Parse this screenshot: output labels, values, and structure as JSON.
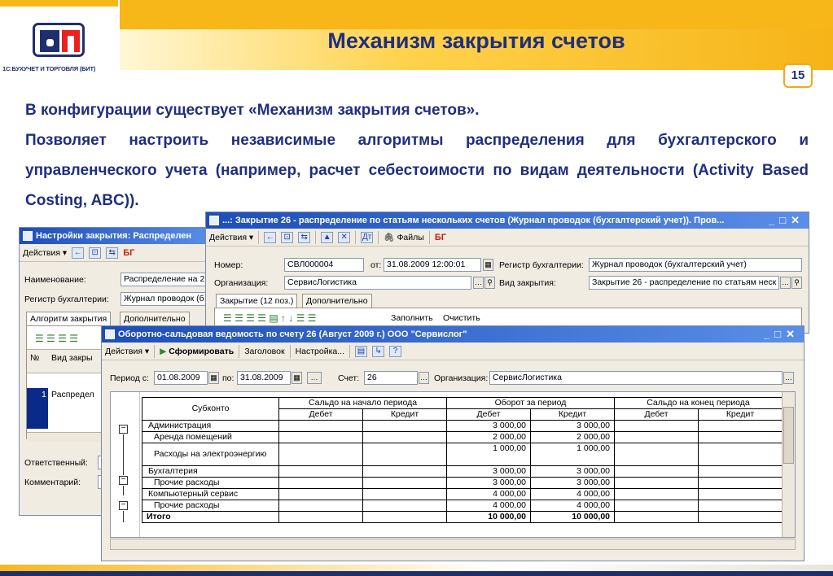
{
  "slide": {
    "logo_caption": "1С:БУХУЧЕТ И ТОРГОВЛЯ (БИТ)",
    "title": "Механизм закрытия счетов",
    "page_number": "15",
    "line1": "В конфигурации существует «Механизм закрытия счетов».",
    "line2": "Позволяет настроить независимые алгоритмы распределения для бухгалтерского и управленческого учета (например, расчет себестоимости по видам деятельности (Activity Based Costing, ABC))."
  },
  "settings_window": {
    "title": "Настройки закрытия: Распределен",
    "toolbar_actions": "Действия ▾",
    "name_label": "Наименование:",
    "name_value": "Распределение на 2",
    "register_label": "Регистр бухгалтерии:",
    "register_value": "Журнал проводок (б",
    "tab_algorithm": "Алгоритм закрытия",
    "tab_additional": "Дополнительно",
    "col_num": "№",
    "col_type": "Вид закры",
    "row_num": "1",
    "row_value": "Распредел",
    "responsible_label": "Ответственный:",
    "comment_label": "Комментарий:"
  },
  "journal_window": {
    "title": "...: Закрытие 26 - распределение по статьям нескольких счетов (Журнал проводок (бухгалтерский учет)). Пров...",
    "toolbar_actions": "Действия ▾",
    "toolbar_files": "Файлы",
    "number_label": "Номер:",
    "number_value": "СВЛ000004",
    "date_label": "от:",
    "date_value": "31.08.2009 12:00:01",
    "register_label": "Регистр бухгалтерии:",
    "register_value": "Журнал проводок (бухгалтерский учет)",
    "org_label": "Организация:",
    "org_value": "СервисЛогистика",
    "closing_type_label": "Вид закрытия:",
    "closing_type_value": "Закрытие 26 - распределение по статьям неск",
    "tab_closing": "Закрытие (12 поз.)",
    "tab_additional": "Дополнительно",
    "fill_button": "Заполнить",
    "clear_button": "Очистить"
  },
  "osv_window": {
    "title": "Оборотно-сальдовая ведомость по счету 26 (Август 2009 г.) ООО \"Сервислог\"",
    "toolbar_actions": "Действия ▾",
    "toolbar_generate": "Сформировать",
    "toolbar_header": "Заголовок",
    "toolbar_settings": "Настройка...",
    "period_from_label": "Период с:",
    "period_from_value": "01.08.2009",
    "period_to_label": "по:",
    "period_to_value": "31.08.2009",
    "account_label": "Счет:",
    "account_value": "26",
    "org_label": "Организация:",
    "org_value": "СервисЛогистика",
    "table": {
      "h_subkonto": "Субконто",
      "h_opening": "Сальдо на начало периода",
      "h_turnover": "Оборот за период",
      "h_closing": "Сальдо на конец периода",
      "h_debit": "Дебет",
      "h_credit": "Кредит",
      "rows": [
        {
          "name": "Администрация",
          "od": "",
          "oc": "",
          "td": "3 000,00",
          "tc": "3 000,00",
          "cd": "",
          "cc": ""
        },
        {
          "name": "Аренда помещений",
          "od": "",
          "oc": "",
          "td": "2 000,00",
          "tc": "2 000,00",
          "cd": "",
          "cc": ""
        },
        {
          "name": "Расходы на электроэнергию",
          "od": "",
          "oc": "",
          "td": "1 000,00",
          "tc": "1 000,00",
          "cd": "",
          "cc": ""
        },
        {
          "name": "Бухгалтерия",
          "od": "",
          "oc": "",
          "td": "3 000,00",
          "tc": "3 000,00",
          "cd": "",
          "cc": ""
        },
        {
          "name": "Прочие расходы",
          "od": "",
          "oc": "",
          "td": "3 000,00",
          "tc": "3 000,00",
          "cd": "",
          "cc": ""
        },
        {
          "name": "Компьютерный сервис",
          "od": "",
          "oc": "",
          "td": "4 000,00",
          "tc": "4 000,00",
          "cd": "",
          "cc": ""
        },
        {
          "name": "Прочие расходы",
          "od": "",
          "oc": "",
          "td": "4 000,00",
          "tc": "4 000,00",
          "cd": "",
          "cc": ""
        }
      ],
      "total": {
        "name": "Итого",
        "od": "",
        "oc": "",
        "td": "10 000,00",
        "tc": "10 000,00",
        "cd": "",
        "cc": ""
      }
    }
  }
}
